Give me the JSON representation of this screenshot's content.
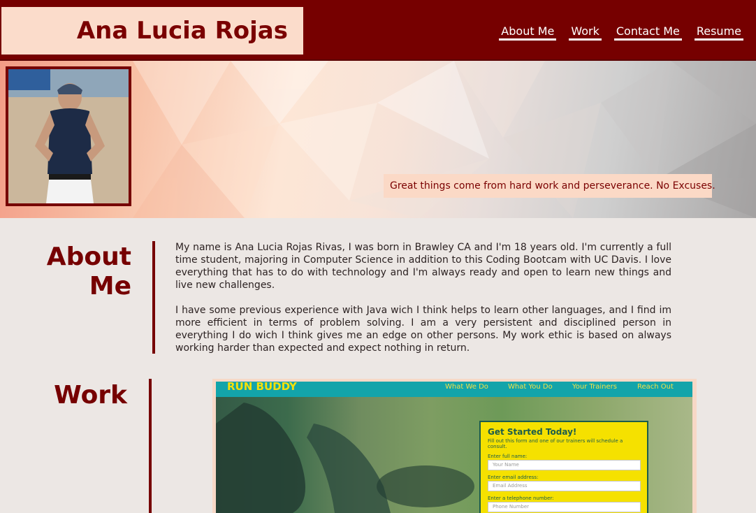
{
  "header": {
    "name": "Ana Lucia Rojas",
    "nav": [
      {
        "label": "About Me"
      },
      {
        "label": "Work"
      },
      {
        "label": "Contact Me"
      },
      {
        "label": "Resume"
      }
    ]
  },
  "hero": {
    "quote": "Great things come from hard work and perseverance. No Excuses."
  },
  "about": {
    "title": "About Me",
    "paragraphs": [
      "My name is Ana Lucia Rojas Rivas, I was born in Brawley CA and I'm 18 years old. I'm currently a full time student, majoring in Computer Science in addition to this Coding Bootcam with UC Davis. I love everything that has to do with technology and I'm always ready and open to learn new things and live new challenges.",
      "I have some previous experience with Java wich I think helps to learn other languages, and I find im more efficient in terms of problem solving. I am a very persistent and disciplined person in everything I do wich I think gives me an edge on other persons. My work ethic is based on always working harder than expected and expect nothing in return."
    ]
  },
  "work": {
    "title": "Work",
    "project": {
      "logo": "RUN BUDDY",
      "nav": [
        "What We Do",
        "What You Do",
        "Your Trainers",
        "Reach Out"
      ],
      "form_title": "Get Started Today!",
      "form_sub": "Fill out this form and one of our trainers will schedule a consult.",
      "fields": [
        {
          "label": "Enter full name:",
          "placeholder": "Your Name"
        },
        {
          "label": "Enter email address:",
          "placeholder": "Email Address"
        },
        {
          "label": "Enter a telephone number:",
          "placeholder": "Phone Number"
        }
      ]
    }
  },
  "colors": {
    "brand": "#760000",
    "accent": "#fbdccb",
    "background": "#ece7e4"
  }
}
